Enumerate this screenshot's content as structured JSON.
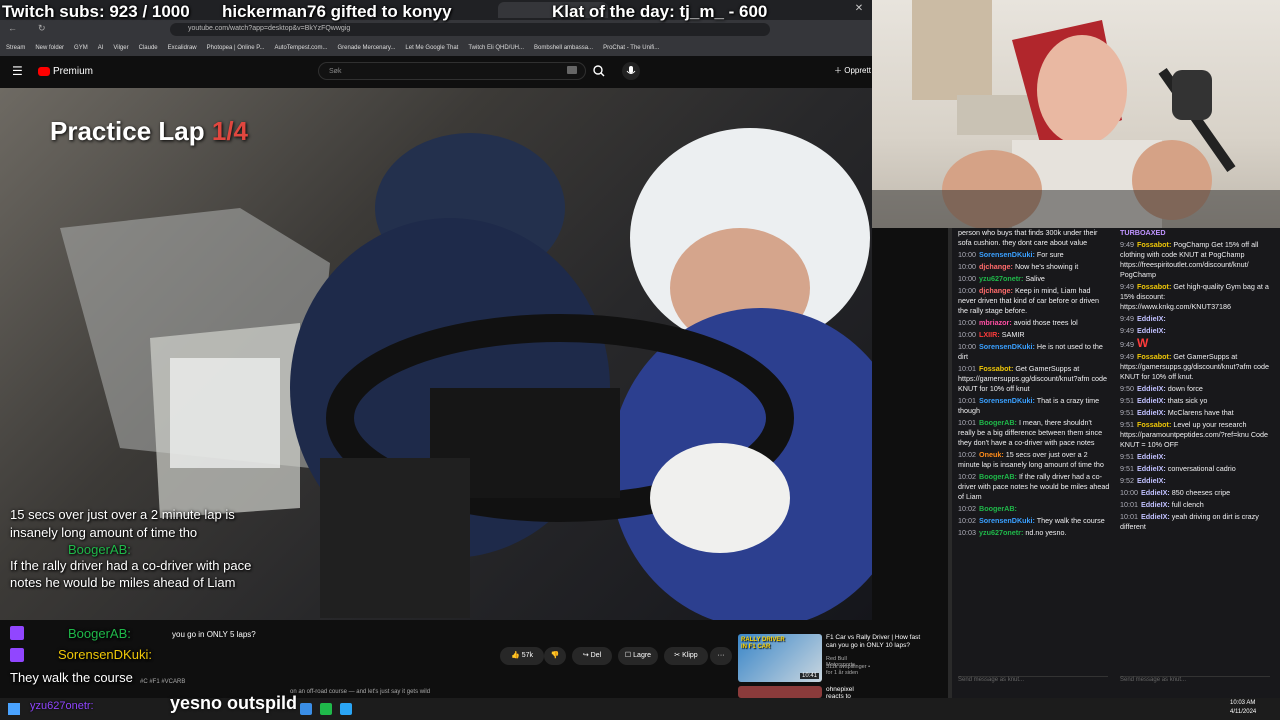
{
  "stream_overlay": {
    "subs_goal": "Twitch subs: 923 / 1000",
    "gift_notice": "hickerman76 gifted to konyy",
    "klat": "Klat of the day: tj_m_ - 600"
  },
  "browser": {
    "url": "youtube.com/watch?app=desktop&v=BkYzFQwwgig",
    "bookmarks": [
      "Stream",
      "New folder",
      "GYM",
      "AI",
      "Vilger",
      "Claude",
      "Excalidraw",
      "Photopea | Online P...",
      "AutoTempest.com...",
      "Grenade Mercenary...",
      "Let Me Google That",
      "Twitch Eli QHD/UH...",
      "Bombshell ambassa...",
      "ProChat - The Unifi..."
    ]
  },
  "youtube": {
    "brand": "Premium",
    "search_placeholder": "Søk",
    "create_label": "Opprett",
    "video_title_overlay": "Practice Lap",
    "lap_counter": "1/4",
    "actions": {
      "likes": "57k",
      "share": "Del",
      "save": "Lagre",
      "clip": "Klipp",
      "more": "···"
    },
    "caption_fragment": "you go in ONLY 5 laps?",
    "hashtag_line": "#C #F1 #VCARB",
    "description_fragment": "on an off-road course — and let's just say it gets wild"
  },
  "recommended": [
    {
      "title": "F1 Car vs Rally Driver | How fast can you go in ONLY 10 laps?",
      "channel": "Red Bull Motorsports",
      "meta": "311k avspillinger • for 1 år siden",
      "duration": "10:41",
      "thumb_text": "RALLY DRIVER IN F1 CAR"
    },
    {
      "title": "ohnepixel reacts to World's",
      "channel": "",
      "meta": "",
      "duration": "",
      "thumb_text": ""
    }
  ],
  "onscreen_chat": [
    {
      "text": "15 secs over just over a 2 minute lap is insanely long amount of time tho",
      "user": ""
    },
    {
      "user": "BoogerAB:",
      "text": "If the rally driver had a co-driver with pace notes he would be miles ahead of Liam"
    },
    {
      "user": "BoogerAB:",
      "text": ""
    },
    {
      "user": "SorensenDKuki:",
      "text": "They walk the course"
    },
    {
      "user": "yzu627onetr:",
      "text": "yesno outspild"
    }
  ],
  "chat_col1": [
    {
      "time": "",
      "user": "",
      "text": "person who buys that finds 300k under their sofa cushion. they dont care about value"
    },
    {
      "time": "10:00",
      "user": "SorensenDKuki:",
      "text": "For sure"
    },
    {
      "time": "10:00",
      "user": "djchange:",
      "text": "Now he's showing it"
    },
    {
      "time": "10:00",
      "user": "yzu627onetr:",
      "text": "Salive"
    },
    {
      "time": "10:00",
      "user": "djchange:",
      "text": "Keep in mind, Liam had never driven that kind of car before or driven the rally stage before."
    },
    {
      "time": "10:00",
      "user": "mbriazor:",
      "text": "avoid those trees lol"
    },
    {
      "time": "10:00",
      "user": "LXIIR:",
      "text": "SAMIR"
    },
    {
      "time": "10:00",
      "user": "SorensenDKuki:",
      "text": "He is not used to the dirt"
    },
    {
      "time": "10:01",
      "user": "Fossabot:",
      "text": "Get GamerSupps at https://gamersupps.gg/discount/knut?afm code KNUT for 10% off knut"
    },
    {
      "time": "10:01",
      "user": "SorensenDKuki:",
      "text": "That is a crazy time though"
    },
    {
      "time": "10:01",
      "user": "BoogerAB:",
      "text": "I mean, there shouldn't really be a big difference between them since they don't have a co-driver with pace notes"
    },
    {
      "time": "10:02",
      "user": "Oneuk:",
      "text": "15 secs over just over a 2 minute lap is insanely long amount of time tho"
    },
    {
      "time": "10:02",
      "user": "BoogerAB:",
      "text": "If the rally driver had a co-driver with pace notes he would be miles ahead of Liam"
    },
    {
      "time": "10:02",
      "user": "BoogerAB:",
      "text": ""
    },
    {
      "time": "10:02",
      "user": "SorensenDKuki:",
      "text": "They walk the course"
    },
    {
      "time": "10:03",
      "user": "yzu627onetr:",
      "text": "nd.no yesno."
    }
  ],
  "chat_col2": [
    {
      "time": "",
      "user": "TURBOAXED",
      "text": ""
    },
    {
      "time": "9:49",
      "user": "Fossabot:",
      "text": "PogChamp Get 15% off all clothing with code KNUT at PogChamp https://freespiritoutlet.com/discount/knut/ PogChamp"
    },
    {
      "time": "9:49",
      "user": "Fossabot:",
      "text": "Get high-quality Gym bag at a 15% discount: https://www.knkg.com/KNUT37186"
    },
    {
      "time": "9:49",
      "user": "EddieIX:",
      "text": ""
    },
    {
      "time": "9:49",
      "user": "EddieIX:",
      "text": ""
    },
    {
      "time": "9:49",
      "user": "",
      "text": "W"
    },
    {
      "time": "9:49",
      "user": "Fossabot:",
      "text": "Get GamerSupps at https://gamersupps.gg/discount/knut?afm code KNUT for 10% off knut."
    },
    {
      "time": "9:50",
      "user": "EddieIX:",
      "text": "down force"
    },
    {
      "time": "9:51",
      "user": "EddieIX:",
      "text": "thats sick yo"
    },
    {
      "time": "9:51",
      "user": "EddieIX:",
      "text": "McClarens have that"
    },
    {
      "time": "9:51",
      "user": "Fossabot:",
      "text": "Level up your research https://paramountpeptides.com/?ref=knu Code KNUT = 10% OFF"
    },
    {
      "time": "9:51",
      "user": "EddieIX:",
      "text": ""
    },
    {
      "time": "9:51",
      "user": "EddieIX:",
      "text": "conversational cadrio"
    },
    {
      "time": "9:52",
      "user": "EddieIX:",
      "text": ""
    },
    {
      "time": "10:00",
      "user": "EddieIX:",
      "text": "850 cheeses cripe"
    },
    {
      "time": "10:01",
      "user": "EddieIX:",
      "text": "full clench"
    },
    {
      "time": "10:01",
      "user": "EddieIX:",
      "text": "yeah driving on dirt is crazy different"
    }
  ],
  "chat_input": {
    "placeholder1": "Send message as knut...",
    "placeholder2": "Send message as knut..."
  },
  "taskbar": {
    "time": "10:03 AM",
    "date": "4/11/2024"
  },
  "colors": {
    "twitch_purple": "#9146ff",
    "yt_red": "#ff0000",
    "chat_bg": "#18181b",
    "green_user": "#1fb94a",
    "yellow_user": "#f0c808"
  }
}
